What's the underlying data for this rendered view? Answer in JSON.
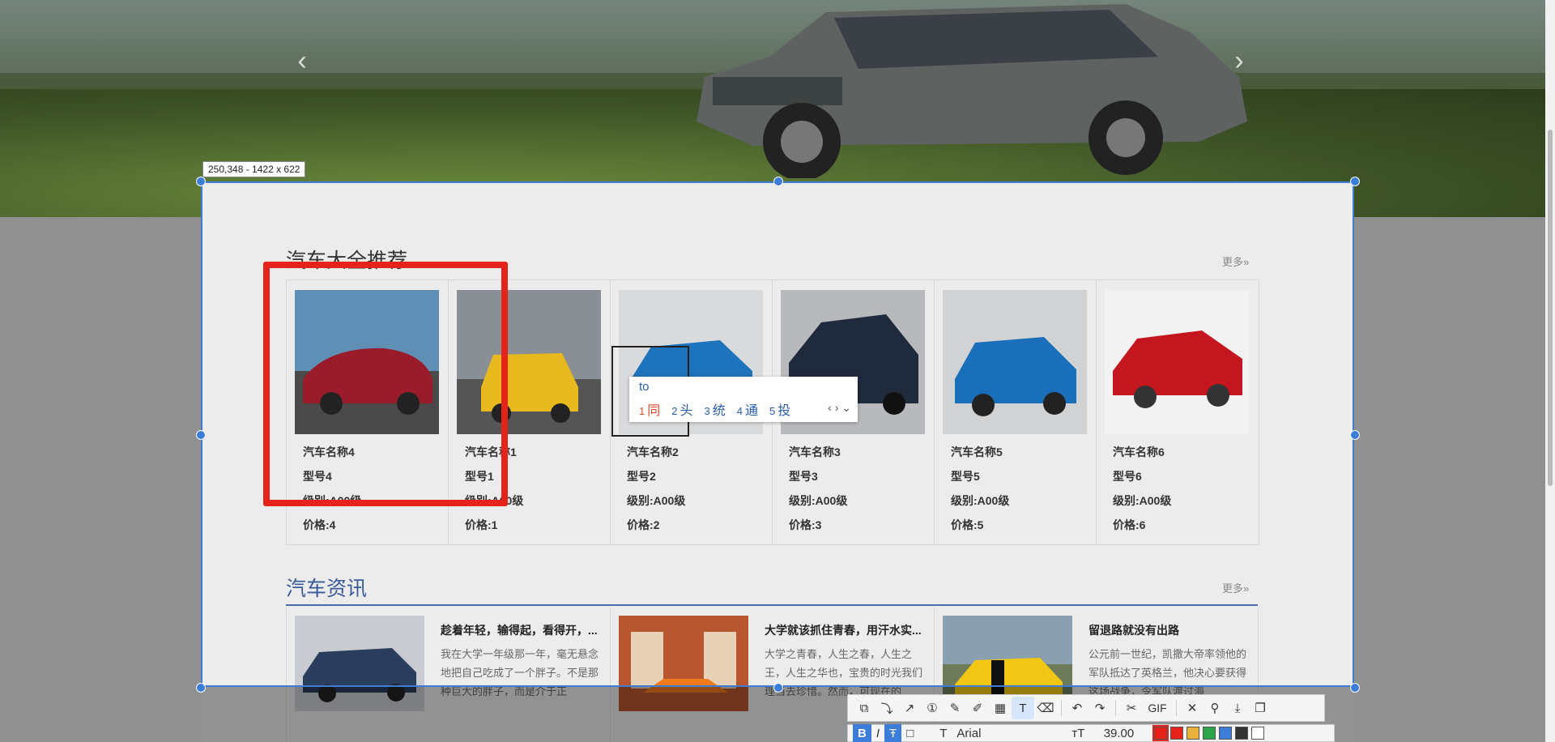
{
  "hero": {
    "prev_arrow": "‹",
    "next_arrow": "›"
  },
  "selection": {
    "dimension_label": "250,348 - 1422 x 622"
  },
  "car_section": {
    "title": "汽车大全推荐",
    "more": "更多»",
    "cards": [
      {
        "name": "汽车名称4",
        "model": "型号4",
        "level": "级别:A00级",
        "price": "价格:4"
      },
      {
        "name": "汽车名称1",
        "model": "型号1",
        "level": "级别:A00级",
        "price": "价格:1"
      },
      {
        "name": "汽车名称2",
        "model": "型号2",
        "level": "级别:A00级",
        "price": "价格:2"
      },
      {
        "name": "汽车名称3",
        "model": "型号3",
        "level": "级别:A00级",
        "price": "价格:3"
      },
      {
        "name": "汽车名称5",
        "model": "型号5",
        "level": "级别:A00级",
        "price": "价格:5"
      },
      {
        "name": "汽车名称6",
        "model": "型号6",
        "level": "级别:A00级",
        "price": "价格:6"
      }
    ]
  },
  "news_section": {
    "title": "汽车资讯",
    "more": "更多»",
    "items": [
      {
        "title": "趁着年轻，输得起，看得开，...",
        "text": "我在大学一年级那一年，毫无悬念地把自己吃成了一个胖子。不是那种巨大的胖子，而是介于正"
      },
      {
        "title": "大学就该抓住青春，用汗水实...",
        "text": "大学之青春，人生之春，人生之王，人生之华也，宝贵的时光我们理当去珍惜。然而，可现在的"
      },
      {
        "title": "留退路就没有出路",
        "text": "公元前一世纪，凯撒大帝率领他的军队抵达了英格兰，他决心要获得这场战争，令军队渡过海"
      }
    ]
  },
  "ime": {
    "composition": "to",
    "candidates": [
      {
        "n": "1",
        "c": "同"
      },
      {
        "n": "2",
        "c": "头"
      },
      {
        "n": "3",
        "c": "统"
      },
      {
        "n": "4",
        "c": "通"
      },
      {
        "n": "5",
        "c": "投"
      }
    ],
    "nav": "‹ › ⌄"
  },
  "toolbar": {
    "gif_label": "GIF",
    "font_name": "Arial",
    "font_size": "39.00",
    "bold": "B",
    "italic": "I",
    "colors": [
      "#e5231b",
      "#e5231b",
      "#e8b23a",
      "#2aa54a",
      "#3b7dd8",
      "#333333",
      "#ffffff"
    ]
  }
}
